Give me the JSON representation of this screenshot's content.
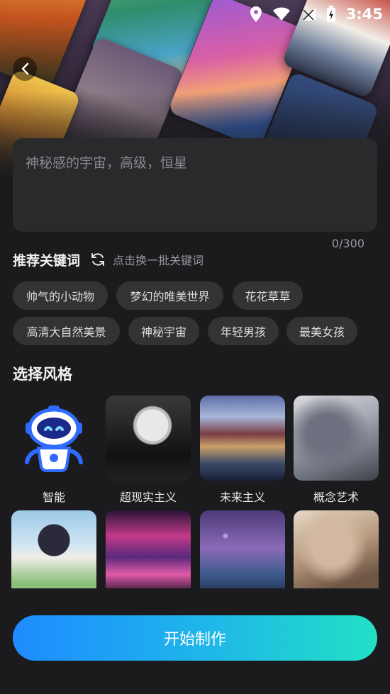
{
  "status_bar": {
    "time": "3:45",
    "icons": [
      "location-icon",
      "wifi-icon",
      "signal-icon",
      "battery-charging-icon"
    ]
  },
  "prompt": {
    "placeholder": "神秘感的宇宙，高级，恒星",
    "value": "",
    "counter": "0/300"
  },
  "keywords": {
    "title": "推荐关键词",
    "refresh_label": "点击换一批关键词",
    "items": [
      "帅气的小动物",
      "梦幻的唯美世界",
      "花花草草",
      "高清大自然美景",
      "神秘宇宙",
      "年轻男孩",
      "最美女孩"
    ]
  },
  "styles": {
    "title": "选择风格",
    "items": [
      {
        "label": "智能"
      },
      {
        "label": "超现实主义"
      },
      {
        "label": "未来主义"
      },
      {
        "label": "概念艺术"
      },
      {
        "label": ""
      },
      {
        "label": ""
      },
      {
        "label": ""
      },
      {
        "label": ""
      }
    ]
  },
  "cta": {
    "label": "开始制作"
  },
  "colors": {
    "background": "#1b1b1e",
    "cta_gradient_start": "#1e8bff",
    "cta_gradient_end": "#22e0c4",
    "robot_blue": "#2f6bff"
  }
}
